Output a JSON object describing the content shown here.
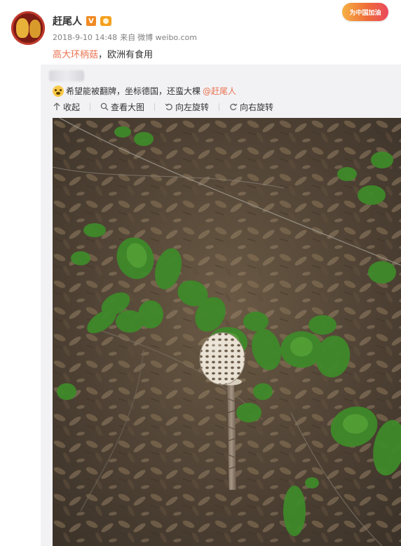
{
  "post": {
    "username": "赶尾人",
    "verified_badge": "V",
    "event_badge": "为中国加油",
    "timestamp": "2018-9-10 14:48",
    "from_label": "来自",
    "source": "微博 weibo.com",
    "text_hashtag": "高大环柄菇",
    "text_rest": "，欧洲有食用"
  },
  "retweet": {
    "text": "希望能被翻牌，坐标德国，还蛮大棵",
    "mention": "@赶尾人",
    "emoji": "hopeful-face-icon"
  },
  "toolbar": {
    "collapse_label": "收起",
    "view_large_label": "查看大图",
    "rotate_left_label": "向左旋转",
    "rotate_right_label": "向右旋转"
  },
  "colors": {
    "link": "#eb7350",
    "retweet_bg": "#f2f2f5",
    "verified": "#f08a24"
  }
}
